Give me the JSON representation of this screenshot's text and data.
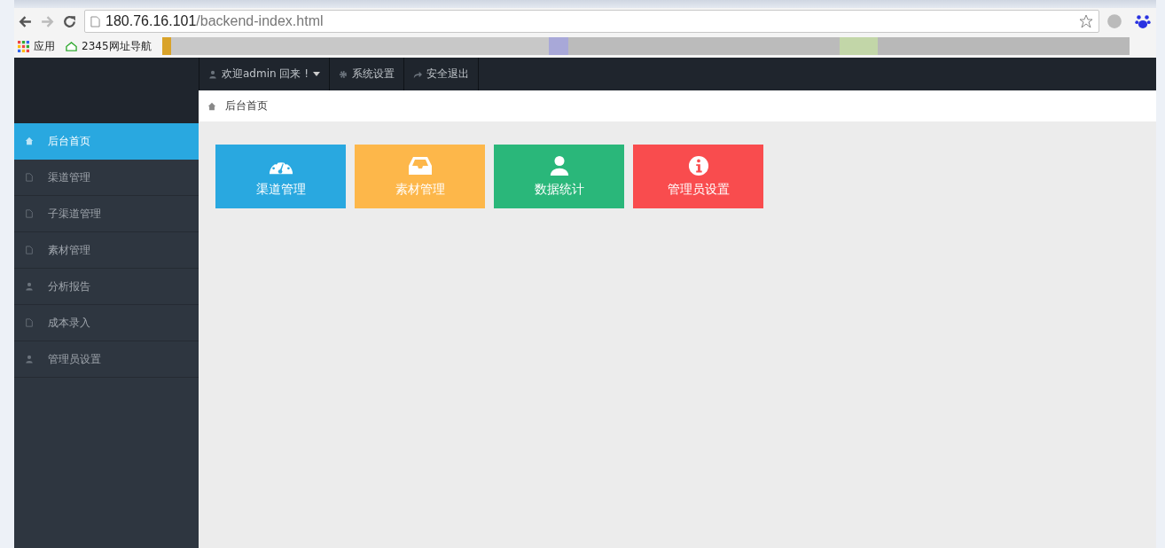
{
  "browser": {
    "url_host": "180.76.16.101",
    "url_path": "/backend-index.html",
    "bookmarks": [
      {
        "label": "应用",
        "kind": "apps"
      },
      {
        "label": "2345网址导航",
        "kind": "house"
      }
    ]
  },
  "topnav": {
    "items": [
      {
        "label": "欢迎admin 回来 !",
        "kind": "user",
        "dropdown": true
      },
      {
        "label": "系统设置",
        "kind": "gear",
        "dropdown": false
      },
      {
        "label": "安全退出",
        "kind": "share",
        "dropdown": false
      }
    ]
  },
  "breadcrumb": "后台首页",
  "sidebar": {
    "items": [
      {
        "label": "后台首页",
        "kind": "home",
        "selected": true
      },
      {
        "label": "渠道管理",
        "kind": "file",
        "selected": false
      },
      {
        "label": "子渠道管理",
        "kind": "file",
        "selected": false
      },
      {
        "label": "素材管理",
        "kind": "file",
        "selected": false
      },
      {
        "label": "分析报告",
        "kind": "user",
        "selected": false
      },
      {
        "label": "成本录入",
        "kind": "file",
        "selected": false
      },
      {
        "label": "管理员设置",
        "kind": "user",
        "selected": false
      }
    ]
  },
  "tiles": [
    {
      "label": "渠道管理",
      "kind": "gauge",
      "color": "#29a8e0"
    },
    {
      "label": "素材管理",
      "kind": "inbox",
      "color": "#fdb74a"
    },
    {
      "label": "数据统计",
      "kind": "user",
      "color": "#2ab77a"
    },
    {
      "label": "管理员设置",
      "kind": "info",
      "color": "#f94c4e"
    }
  ]
}
